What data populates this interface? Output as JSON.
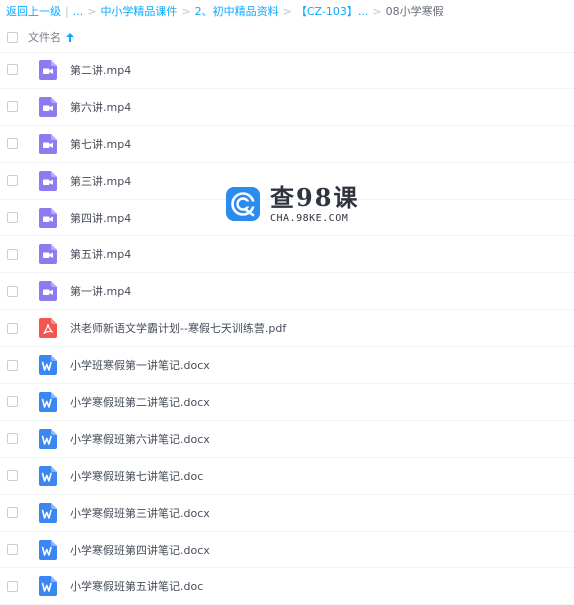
{
  "breadcrumb": {
    "back": "返回上一级",
    "sep": "|",
    "ellipsis": "...",
    "arrow": ">",
    "items": [
      "中小学精品课件",
      "2、初中精品资料",
      "【CZ-103】..."
    ],
    "current": "08小学寒假"
  },
  "table": {
    "column_filename": "文件名",
    "sort_icon": "arrow-up-icon",
    "colors": {
      "accent": "#09aaff",
      "video": "#8c7cf0",
      "pdf": "#f4554f",
      "word": "#3a86f2"
    }
  },
  "files": [
    {
      "name": "第二讲.mp4",
      "type": "video"
    },
    {
      "name": "第六讲.mp4",
      "type": "video"
    },
    {
      "name": "第七讲.mp4",
      "type": "video"
    },
    {
      "name": "第三讲.mp4",
      "type": "video"
    },
    {
      "name": "第四讲.mp4",
      "type": "video"
    },
    {
      "name": "第五讲.mp4",
      "type": "video"
    },
    {
      "name": "第一讲.mp4",
      "type": "video"
    },
    {
      "name": "洪老师新语文学霸计划--寒假七天训练营.pdf",
      "type": "pdf"
    },
    {
      "name": "小学班寒假第一讲笔记.docx",
      "type": "word"
    },
    {
      "name": "小学寒假班第二讲笔记.docx",
      "type": "word"
    },
    {
      "name": "小学寒假班第六讲笔记.docx",
      "type": "word"
    },
    {
      "name": "小学寒假班第七讲笔记.doc",
      "type": "word"
    },
    {
      "name": "小学寒假班第三讲笔记.docx",
      "type": "word"
    },
    {
      "name": "小学寒假班第四讲笔记.docx",
      "type": "word"
    },
    {
      "name": "小学寒假班第五讲笔记.doc",
      "type": "word"
    }
  ],
  "watermark": {
    "title": "查98课",
    "url": "CHA.98KE.COM",
    "logo_icon": "c-logo-icon",
    "color": "#2a8cf0"
  }
}
